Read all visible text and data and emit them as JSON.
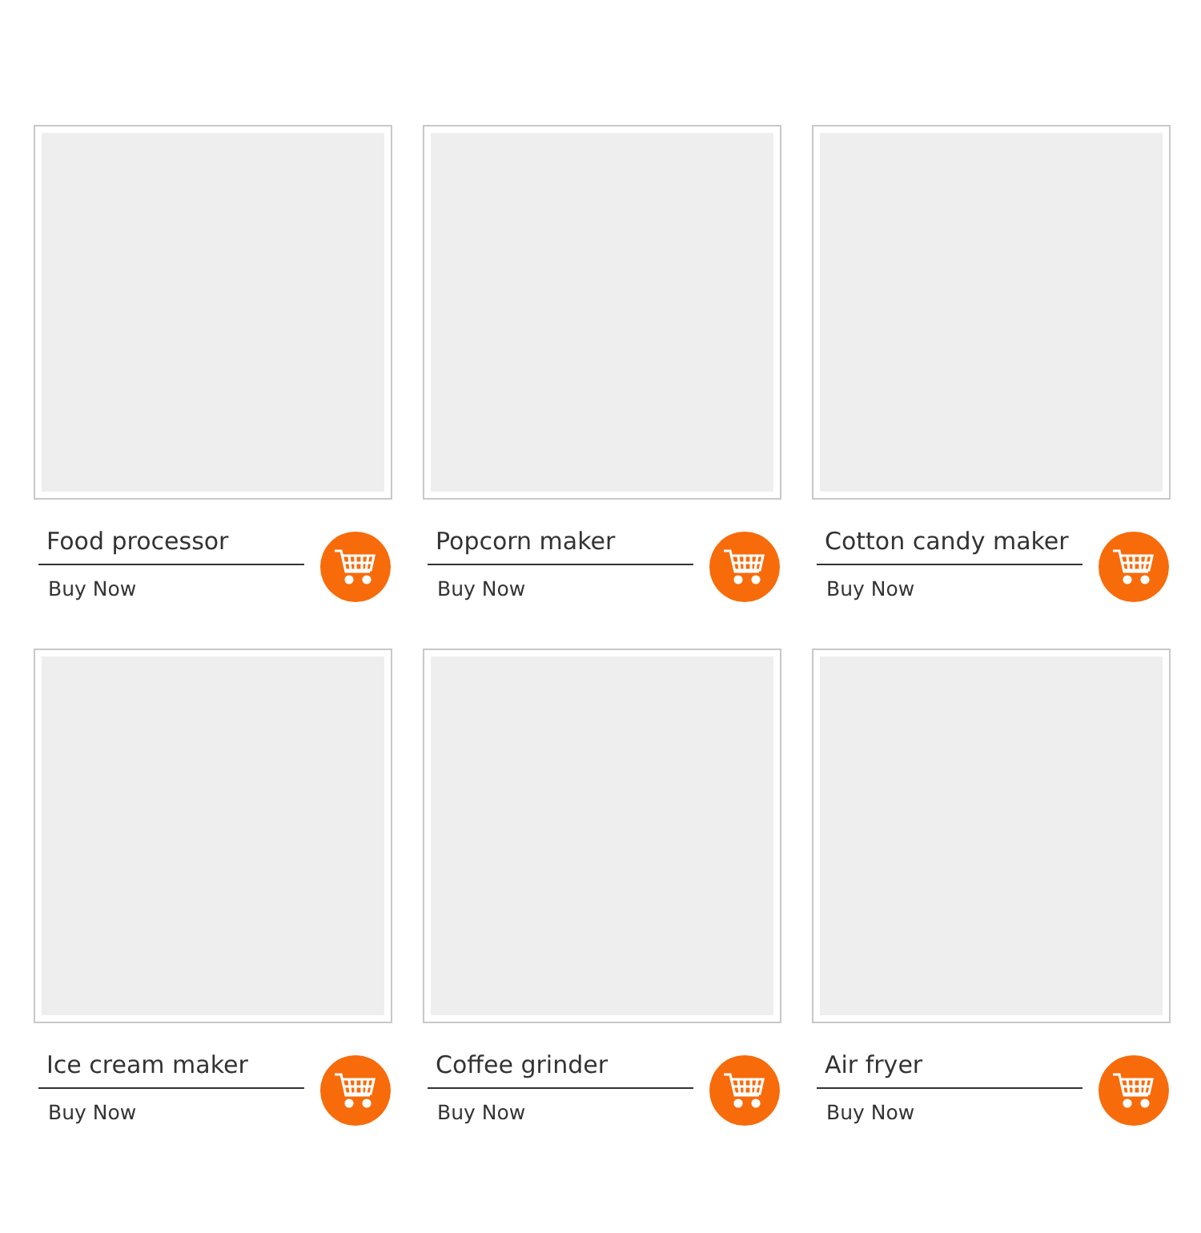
{
  "products": [
    {
      "name": "Food processor",
      "action": "Buy Now"
    },
    {
      "name": "Popcorn maker",
      "action": "Buy Now"
    },
    {
      "name": "Cotton candy maker",
      "action": "Buy Now"
    },
    {
      "name": "Ice cream maker",
      "action": "Buy Now"
    },
    {
      "name": "Coffee grinder",
      "action": "Buy Now"
    },
    {
      "name": "Air fryer",
      "action": "Buy Now"
    }
  ]
}
